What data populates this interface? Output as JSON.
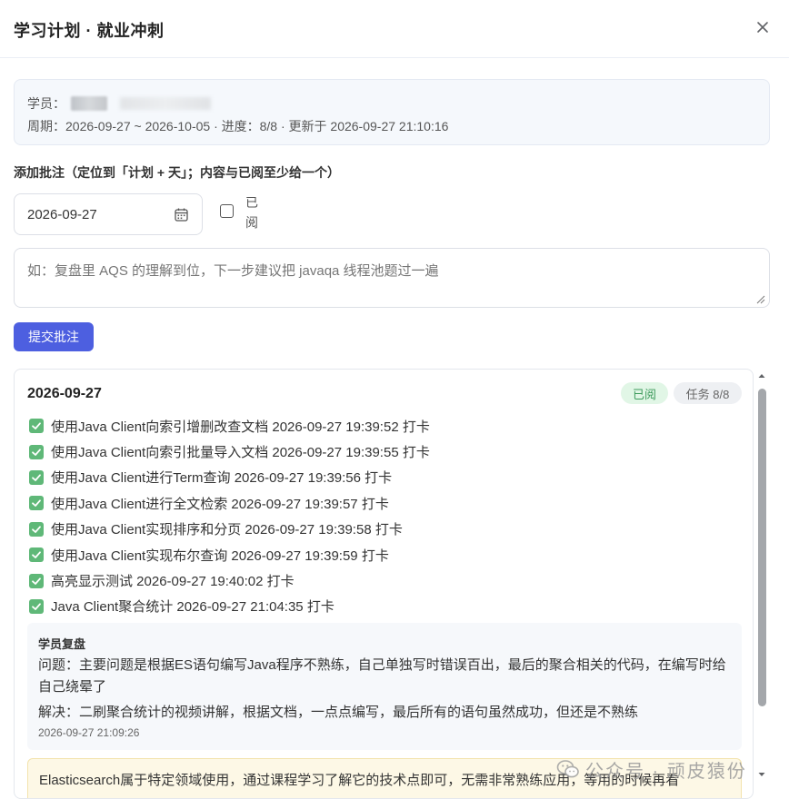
{
  "dialog": {
    "title": "学习计划 · 就业冲刺"
  },
  "info": {
    "student_label": "学员：",
    "period_line": "周期：2026-09-27 ~ 2026-10-05 · 进度：8/8 · 更新于 2026-09-27 21:10:16"
  },
  "form": {
    "section_label": "添加批注（定位到「计划 + 天」；内容与已阅至少给一个）",
    "date_value": "2026-09-27",
    "read_label": "已阅",
    "comment_placeholder": "如：复盘里 AQS 的理解到位，下一步建议把 javaqa 线程池题过一遍",
    "submit_label": "提交批注"
  },
  "day": {
    "date": "2026-09-27",
    "badge_read": "已阅",
    "badge_tasks": "任务 8/8",
    "tasks": [
      "使用Java Client向索引增删改查文档 2026-09-27 19:39:52 打卡",
      "使用Java Client向索引批量导入文档 2026-09-27 19:39:55 打卡",
      "使用Java Client进行Term查询 2026-09-27 19:39:56 打卡",
      "使用Java Client进行全文检索 2026-09-27 19:39:57 打卡",
      "使用Java Client实现排序和分页 2026-09-27 19:39:58 打卡",
      "使用Java Client实现布尔查询 2026-09-27 19:39:59 打卡",
      "高亮显示测试 2026-09-27 19:40:02 打卡",
      "Java Client聚合统计 2026-09-27 21:04:35 打卡"
    ],
    "review": {
      "title": "学员复盘",
      "problem": "问题：主要问题是根据ES语句编写Java程序不熟练，自己单独写时错误百出，最后的聚合相关的代码，在编写时给自己绕晕了",
      "solution": "解决：二刷聚合统计的视频讲解，根据文档，一点点编写，最后所有的语句虽然成功，但还是不熟练",
      "time": "2026-09-27 21:09:26"
    },
    "teacher_comment": "Elasticsearch属于特定领域使用，通过课程学习了解它的技术点即可，无需非常熟练应用，等用的时候再看"
  },
  "watermark": {
    "text": "公众号 · 顽皮猿份"
  },
  "icons": {
    "close": "close-icon",
    "calendar": "calendar-icon",
    "check": "check-icon",
    "wechat": "wechat-icon"
  },
  "colors": {
    "primary": "#4d5fe0",
    "check_green": "#5fb878",
    "badge_read_bg": "#e1f6e6",
    "badge_read_text": "#3d9a5c",
    "teacher_bg": "#fdf8e6"
  }
}
